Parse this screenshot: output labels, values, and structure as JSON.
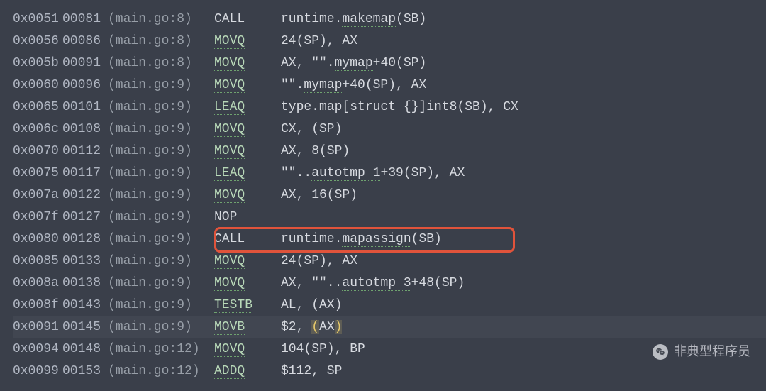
{
  "rows": [
    {
      "hex": "0x0051",
      "dec": "00081",
      "loc": "(main.go:8)",
      "mnem": "CALL",
      "mUnd": false,
      "ops": [
        {
          "t": "runtime."
        },
        {
          "t": "makemap",
          "u": true
        },
        {
          "t": "(SB)"
        }
      ]
    },
    {
      "hex": "0x0056",
      "dec": "00086",
      "loc": "(main.go:8)",
      "mnem": "MOVQ",
      "mUnd": true,
      "ops": [
        {
          "t": "24(SP), AX"
        }
      ]
    },
    {
      "hex": "0x005b",
      "dec": "00091",
      "loc": "(main.go:8)",
      "mnem": "MOVQ",
      "mUnd": true,
      "ops": [
        {
          "t": "AX, \"\"."
        },
        {
          "t": "mymap",
          "u": true
        },
        {
          "t": "+40(SP)"
        }
      ]
    },
    {
      "hex": "0x0060",
      "dec": "00096",
      "loc": "(main.go:9)",
      "mnem": "MOVQ",
      "mUnd": true,
      "ops": [
        {
          "t": "\"\"."
        },
        {
          "t": "mymap",
          "u": true
        },
        {
          "t": "+40(SP), AX"
        }
      ]
    },
    {
      "hex": "0x0065",
      "dec": "00101",
      "loc": "(main.go:9)",
      "mnem": "LEAQ",
      "mUnd": true,
      "ops": [
        {
          "t": "type.map[struct {}]int8(SB), CX"
        }
      ]
    },
    {
      "hex": "0x006c",
      "dec": "00108",
      "loc": "(main.go:9)",
      "mnem": "MOVQ",
      "mUnd": true,
      "ops": [
        {
          "t": "CX, (SP)"
        }
      ]
    },
    {
      "hex": "0x0070",
      "dec": "00112",
      "loc": "(main.go:9)",
      "mnem": "MOVQ",
      "mUnd": true,
      "ops": [
        {
          "t": "AX, 8(SP)"
        }
      ]
    },
    {
      "hex": "0x0075",
      "dec": "00117",
      "loc": "(main.go:9)",
      "mnem": "LEAQ",
      "mUnd": true,
      "ops": [
        {
          "t": "\"\".."
        },
        {
          "t": "autotmp_1",
          "u": true
        },
        {
          "t": "+39(SP), AX"
        }
      ]
    },
    {
      "hex": "0x007a",
      "dec": "00122",
      "loc": "(main.go:9)",
      "mnem": "MOVQ",
      "mUnd": true,
      "ops": [
        {
          "t": "AX, 16(SP)"
        }
      ]
    },
    {
      "hex": "0x007f",
      "dec": "00127",
      "loc": "(main.go:9)",
      "mnem": "NOP",
      "mUnd": false,
      "ops": []
    },
    {
      "hex": "0x0080",
      "dec": "00128",
      "loc": "(main.go:9)",
      "mnem": "CALL",
      "mUnd": false,
      "ops": [
        {
          "t": "runtime."
        },
        {
          "t": "mapassign",
          "u": true
        },
        {
          "t": "(SB)"
        }
      ],
      "box": true
    },
    {
      "hex": "0x0085",
      "dec": "00133",
      "loc": "(main.go:9)",
      "mnem": "MOVQ",
      "mUnd": true,
      "ops": [
        {
          "t": "24(SP), AX"
        }
      ]
    },
    {
      "hex": "0x008a",
      "dec": "00138",
      "loc": "(main.go:9)",
      "mnem": "MOVQ",
      "mUnd": true,
      "ops": [
        {
          "t": "AX, \"\".."
        },
        {
          "t": "autotmp_3",
          "u": true
        },
        {
          "t": "+48(SP)"
        }
      ]
    },
    {
      "hex": "0x008f",
      "dec": "00143",
      "loc": "(main.go:9)",
      "mnem": "TESTB",
      "mUnd": true,
      "ops": [
        {
          "t": "AL, (AX)"
        }
      ]
    },
    {
      "hex": "0x0091",
      "dec": "00145",
      "loc": "(main.go:9)",
      "mnem": "MOVB",
      "mUnd": true,
      "ops": [
        {
          "t": "$2, "
        },
        {
          "t": "(",
          "y": true
        },
        {
          "t": "AX"
        },
        {
          "t": ")",
          "y": true
        }
      ],
      "hl": true
    },
    {
      "hex": "0x0094",
      "dec": "00148",
      "loc": "(main.go:12)",
      "mnem": "MOVQ",
      "mUnd": true,
      "ops": [
        {
          "t": "104(SP), BP"
        }
      ]
    },
    {
      "hex": "0x0099",
      "dec": "00153",
      "loc": "(main.go:12)",
      "mnem": "ADDQ",
      "mUnd": true,
      "ops": [
        {
          "t": "$112, SP"
        }
      ]
    }
  ],
  "watermark": "非典型程序员"
}
